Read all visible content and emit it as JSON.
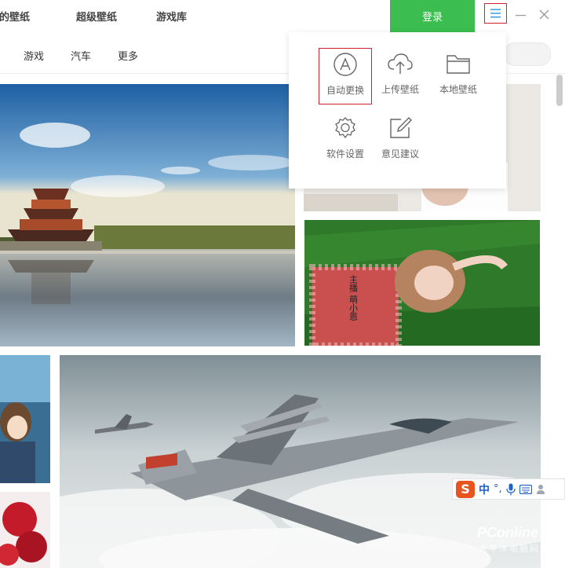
{
  "header": {
    "tabs": [
      {
        "label": "我的壁纸"
      },
      {
        "label": "超级壁纸"
      },
      {
        "label": "游戏库"
      }
    ],
    "login_label": "登录"
  },
  "categories": [
    {
      "label": "游戏"
    },
    {
      "label": "汽车"
    },
    {
      "label": "更多"
    }
  ],
  "menu": {
    "items": [
      {
        "label": "自动更换",
        "icon": "auto-change-icon"
      },
      {
        "label": "上传壁纸",
        "icon": "cloud-upload-icon"
      },
      {
        "label": "本地壁纸",
        "icon": "folder-icon"
      },
      {
        "label": "软件设置",
        "icon": "gear-icon"
      },
      {
        "label": "意见建议",
        "icon": "edit-icon"
      }
    ]
  },
  "wallpapers": {
    "portrait_caption": "主播 萌小恩"
  },
  "ime": {
    "logo": "S",
    "mode": "中"
  },
  "watermark": {
    "brand": "PConline",
    "sub": "太平洋电脑网"
  },
  "colors": {
    "accent_green": "#3bbd4f",
    "highlight_red": "#d2222d",
    "icon_blue": "#1a8fe0"
  }
}
